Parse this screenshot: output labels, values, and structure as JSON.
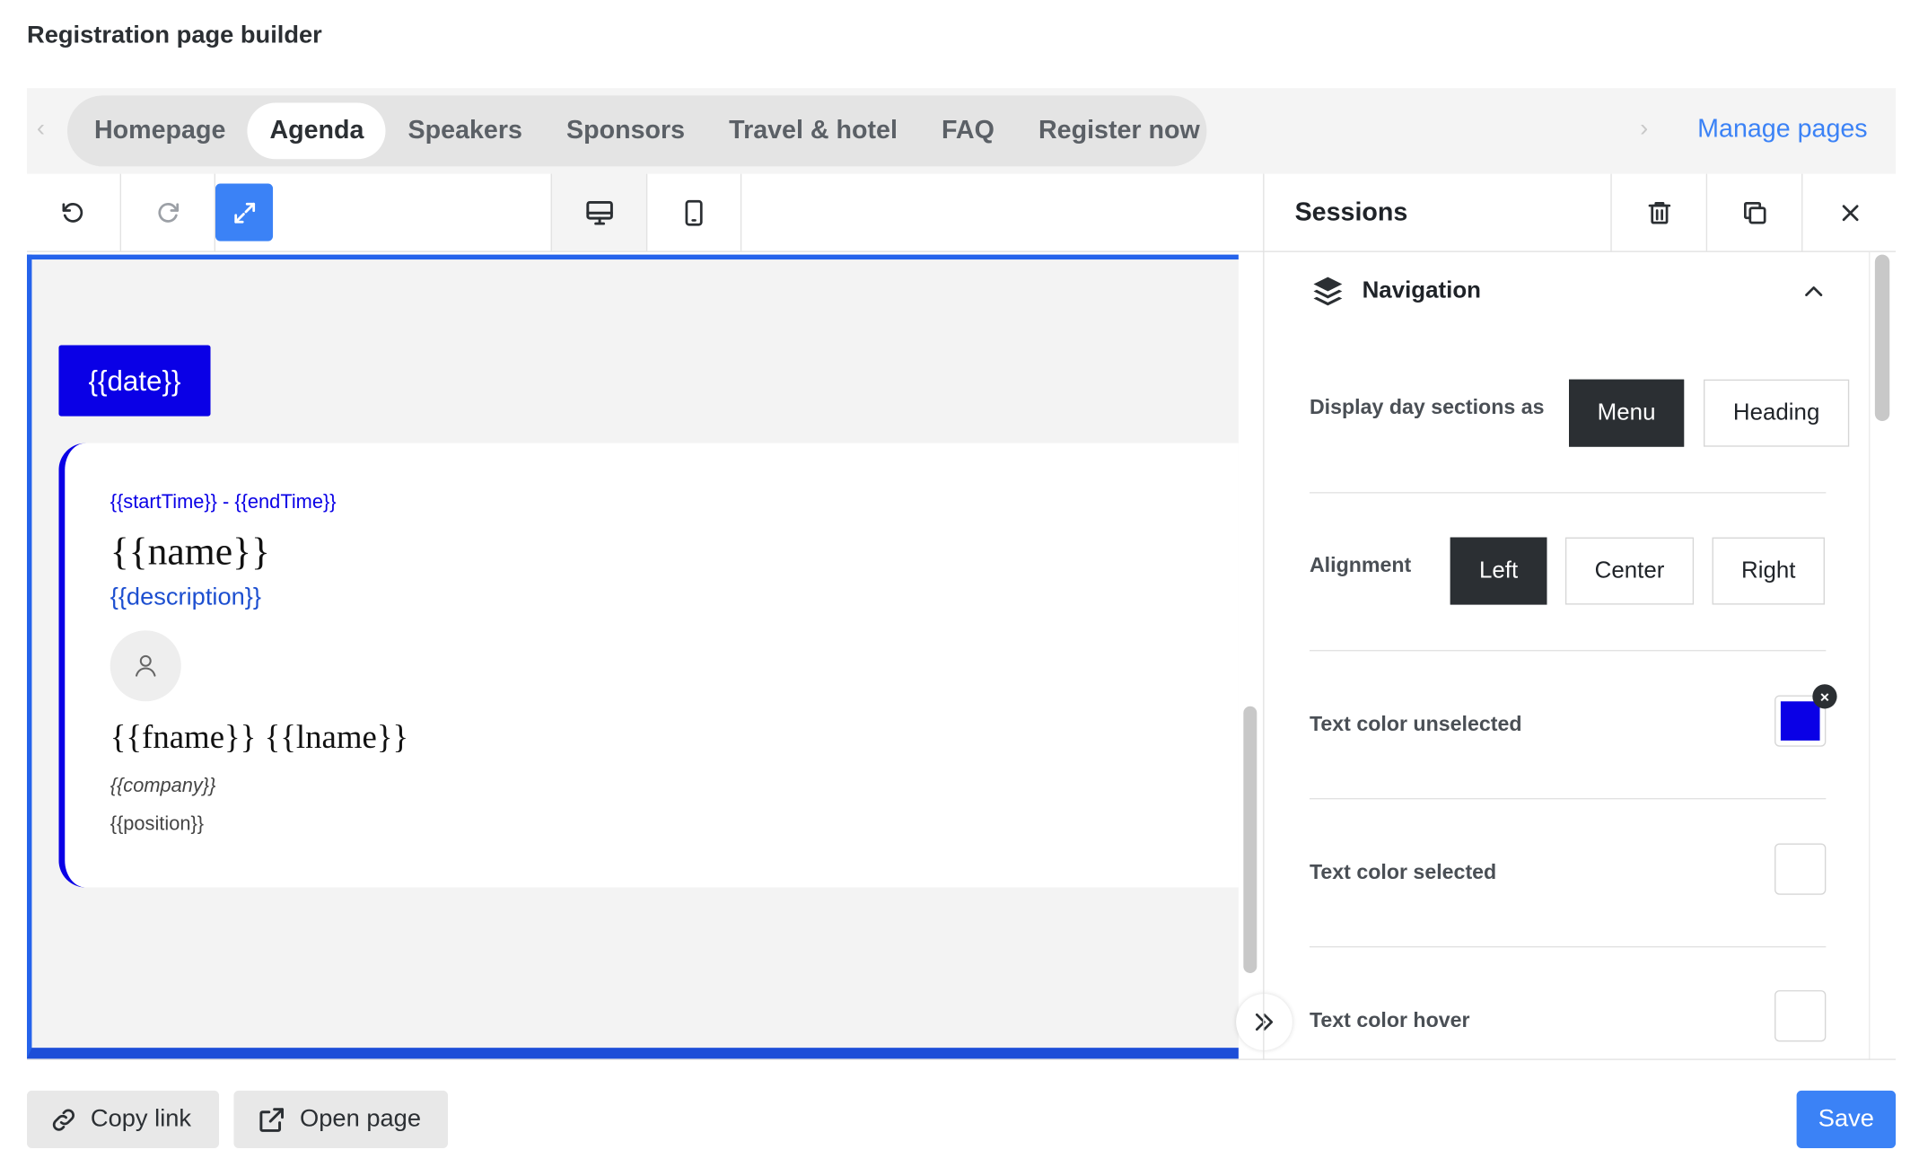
{
  "page_title": "Registration page builder",
  "tabs": [
    {
      "label": "Homepage",
      "active": false
    },
    {
      "label": "Agenda",
      "active": true
    },
    {
      "label": "Speakers",
      "active": false
    },
    {
      "label": "Sponsors",
      "active": false
    },
    {
      "label": "Travel & hotel",
      "active": false
    },
    {
      "label": "FAQ",
      "active": false
    },
    {
      "label": "Register now",
      "active": false
    }
  ],
  "manage_pages": "Manage pages",
  "toolbar": {
    "icons": [
      "undo-icon",
      "redo-icon",
      "fullscreen-icon",
      "desktop-icon",
      "mobile-icon"
    ],
    "accent": "#3b82f6"
  },
  "canvas": {
    "date": "{{date}}",
    "session": {
      "time": "{{startTime}} - {{endTime}}",
      "name": "{{name}}",
      "description": "{{description}}",
      "speaker": "{{fname}} {{lname}}",
      "company": "{{company}}",
      "position": "{{position}}"
    },
    "accent": "#0a00e6"
  },
  "panel": {
    "title": "Sessions",
    "section_title": "Navigation",
    "display_label": "Display day sections as",
    "display_options": [
      {
        "label": "Menu",
        "selected": true
      },
      {
        "label": "Heading",
        "selected": false
      }
    ],
    "alignment_label": "Alignment",
    "alignment_options": [
      {
        "label": "Left",
        "selected": true
      },
      {
        "label": "Center",
        "selected": false
      },
      {
        "label": "Right",
        "selected": false
      }
    ],
    "text_color_unselected_label": "Text color unselected",
    "text_color_unselected_value": "#0a00e6",
    "text_color_selected_label": "Text color selected",
    "text_color_hover_label": "Text color hover"
  },
  "bottom": {
    "copy_link": "Copy link",
    "open_page": "Open page",
    "save": "Save"
  }
}
